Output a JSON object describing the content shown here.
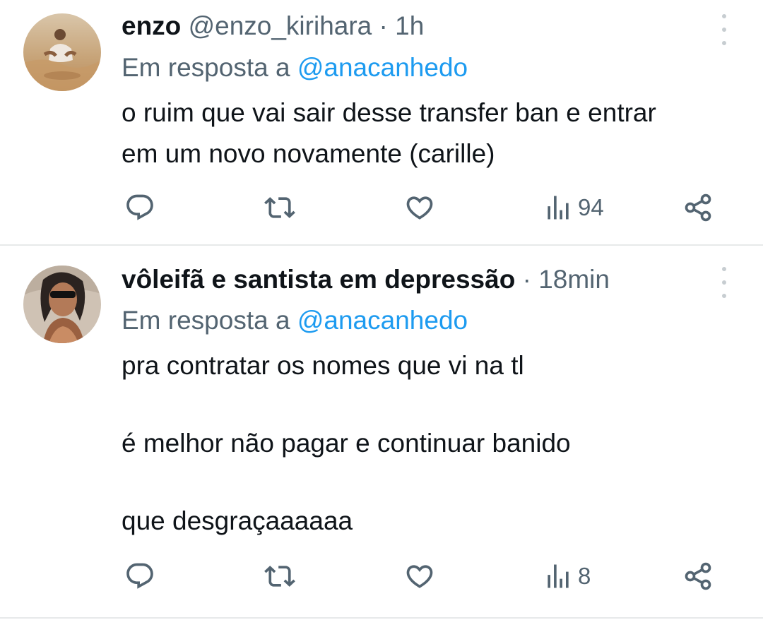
{
  "tweets": [
    {
      "name": "enzo",
      "handle": "@enzo_kirihara",
      "separator": "·",
      "time": "1h",
      "replying_prefix": "Em resposta a ",
      "replying_to": "@anacanhedo",
      "text": "o ruim que vai sair desse transfer ban e entrar\nem um novo novamente (carille)",
      "views": "94",
      "icons": [
        "reply-icon",
        "retweet-icon",
        "like-icon",
        "views-icon",
        "share-icon",
        "more-icon"
      ]
    },
    {
      "name": "vôleifã e santista em depressão",
      "handle": "",
      "separator": "·",
      "time": "18min",
      "replying_prefix": "Em resposta a ",
      "replying_to": "@anacanhedo",
      "text": "pra contratar os nomes que vi na tl\n\né melhor não pagar e continuar banido\n\nque desgraçaaaaaa",
      "views": "8",
      "icons": [
        "reply-icon",
        "retweet-icon",
        "like-icon",
        "views-icon",
        "share-icon",
        "more-icon"
      ]
    }
  ],
  "colors": {
    "text": "#0f1419",
    "secondary": "#536471",
    "accent": "#1d9bf0",
    "divider": "#e7e9ea"
  }
}
